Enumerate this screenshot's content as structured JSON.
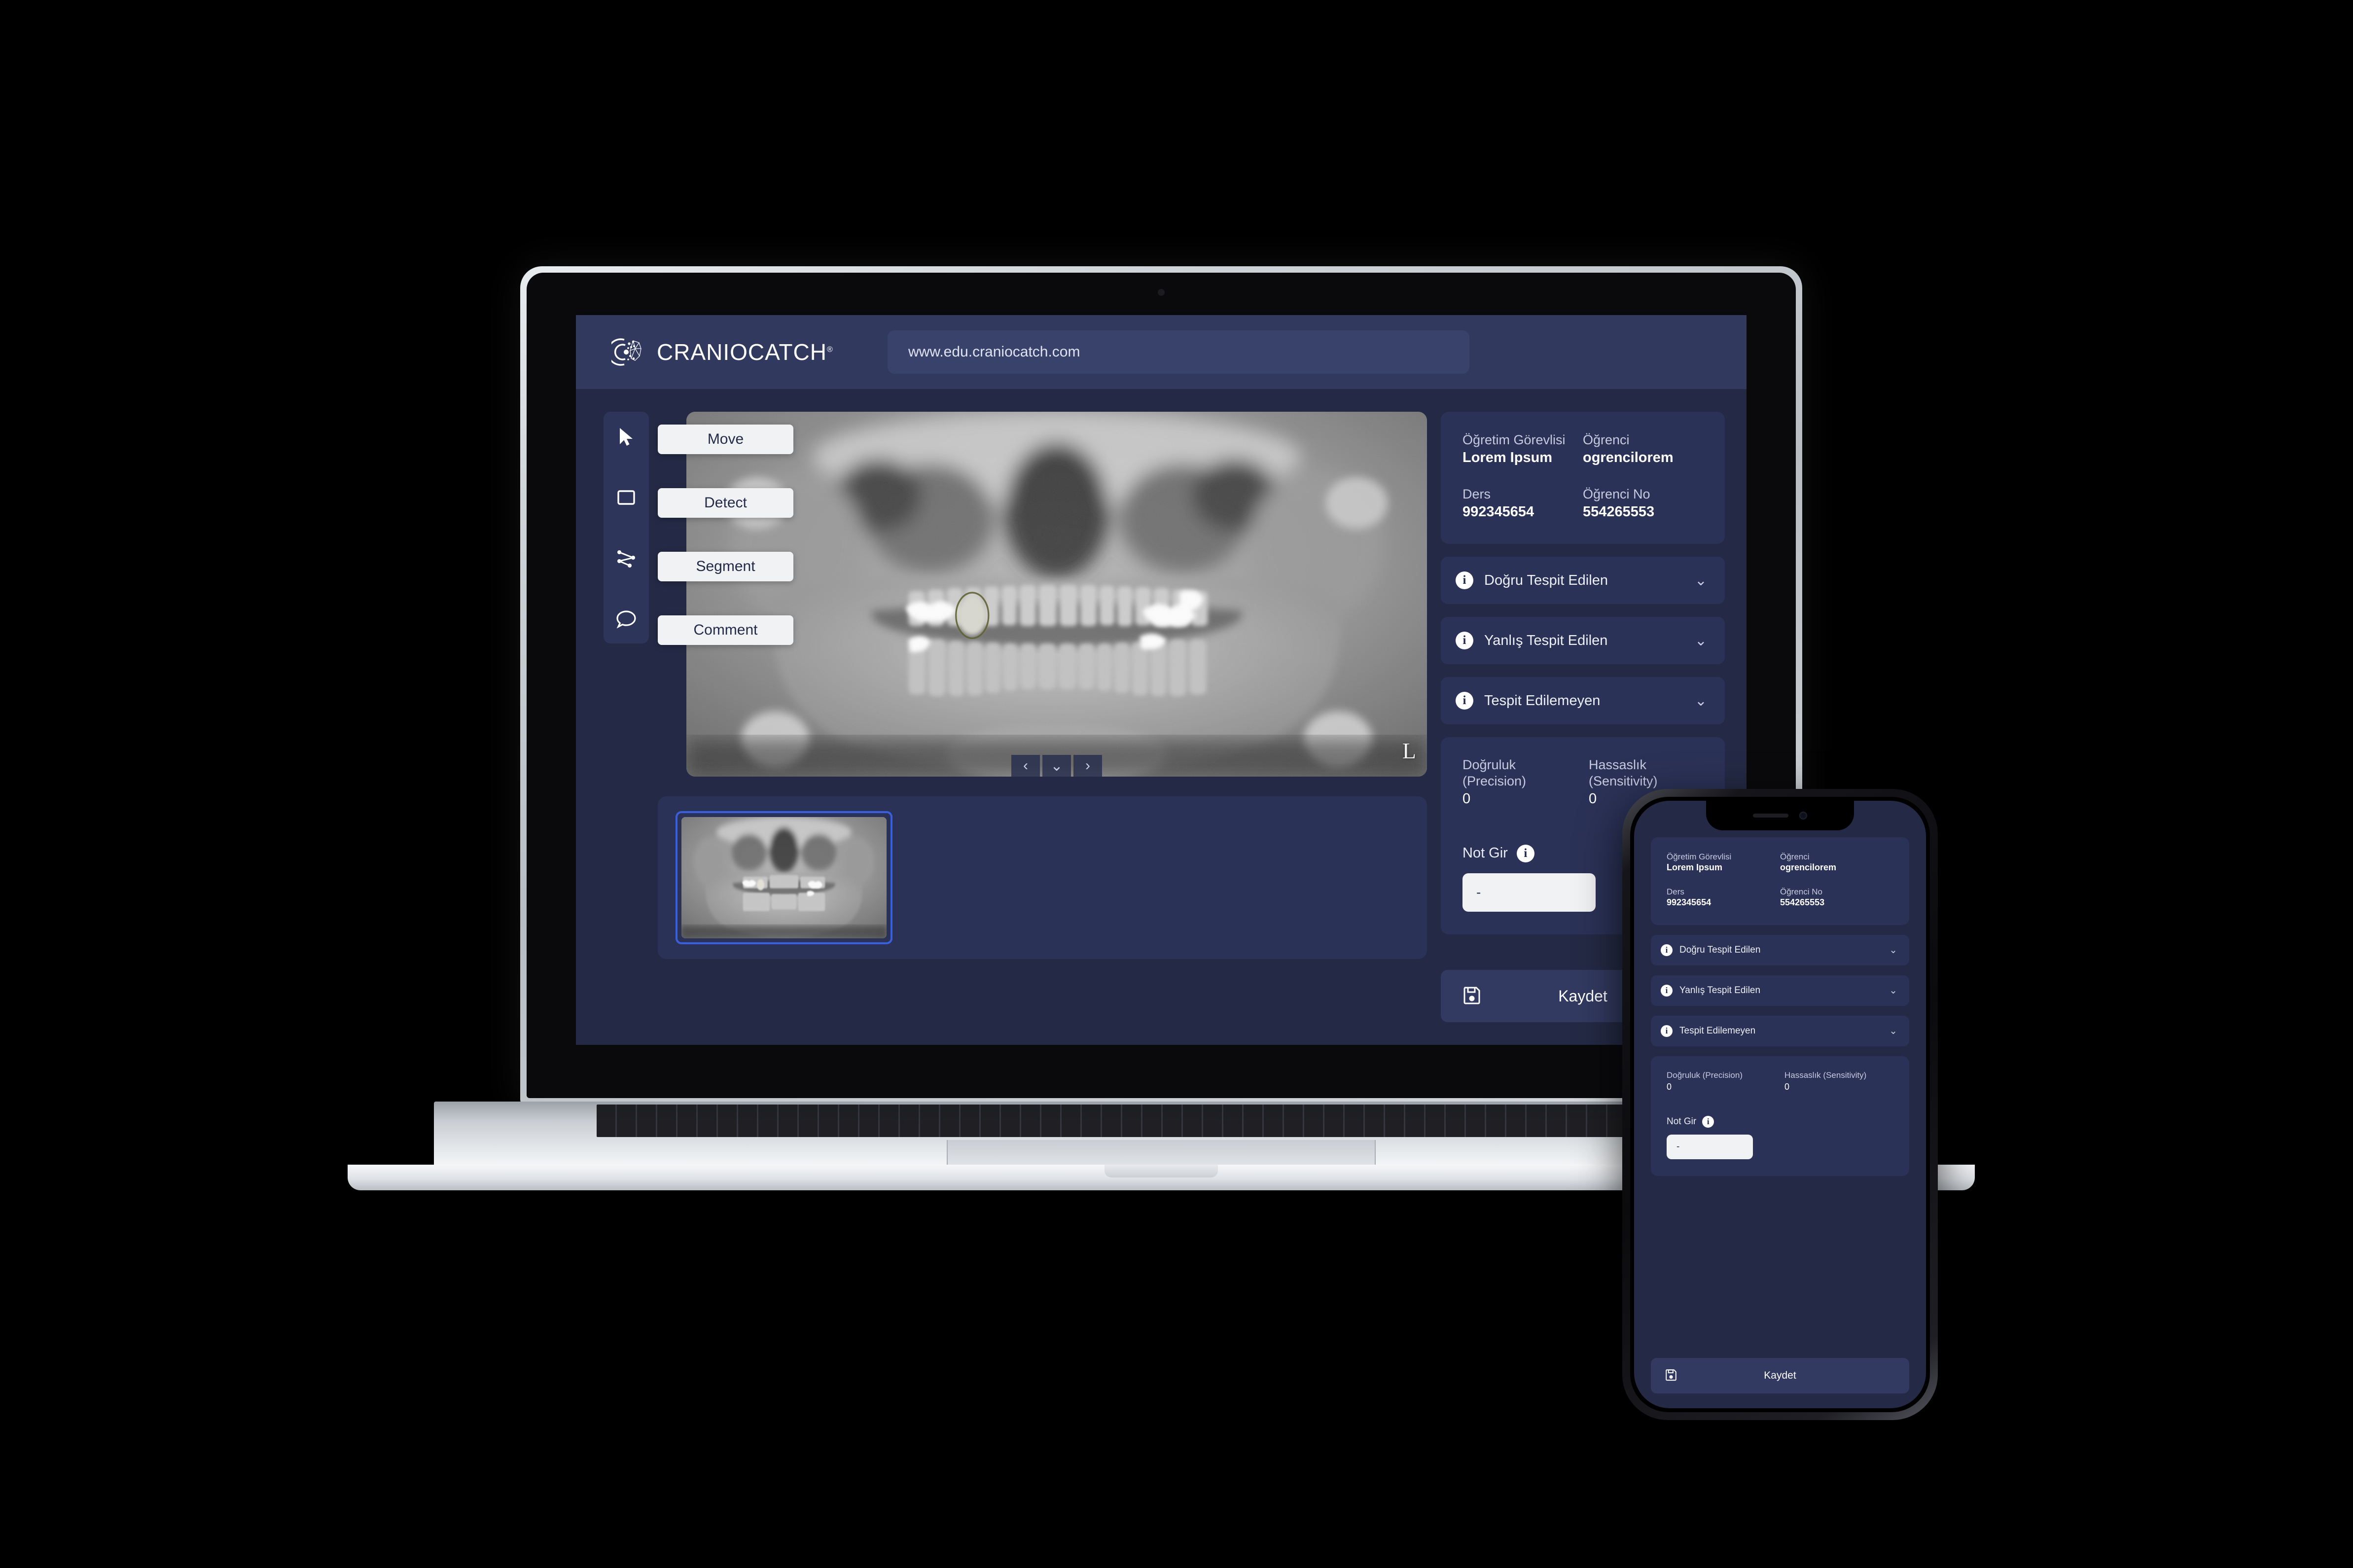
{
  "brand": {
    "name": "CRANIOCATCH",
    "registered_mark": "®",
    "logo_icon": "craniocatch-logo-icon"
  },
  "browser": {
    "url": "www.edu.craniocatch.com"
  },
  "toolbar": {
    "tools": [
      {
        "icon": "cursor-arrow-icon",
        "name": "move-tool"
      },
      {
        "icon": "rectangle-icon",
        "name": "detect-tool"
      },
      {
        "icon": "polyline-nodes-icon",
        "name": "segment-tool"
      },
      {
        "icon": "speech-bubble-icon",
        "name": "comment-tool"
      }
    ]
  },
  "modes": [
    {
      "label": "Move"
    },
    {
      "label": "Detect"
    },
    {
      "label": "Segment"
    },
    {
      "label": "Comment"
    }
  ],
  "viewer": {
    "orientation_marker": "L",
    "nav": {
      "prev": "‹",
      "dropdown": "⌄",
      "next": "›"
    }
  },
  "thumbnails": [
    {
      "selected": true,
      "alt": "panoramic-dental-xray-thumbnail"
    }
  ],
  "info": {
    "fields": [
      {
        "label": "Öğretim Görevlisi",
        "value": "Lorem Ipsum"
      },
      {
        "label": "Öğrenci",
        "value": "ogrencilorem"
      },
      {
        "label": "Ders",
        "value": "992345654"
      },
      {
        "label": "Öğrenci No",
        "value": "554265553"
      }
    ]
  },
  "accordions": [
    {
      "label": "Doğru Tespit Edilen",
      "icon": "info-icon",
      "chevron": "⌄"
    },
    {
      "label": "Yanlış Tespit Edilen",
      "icon": "info-icon",
      "chevron": "⌄"
    },
    {
      "label": "Tespit Edilemeyen",
      "icon": "info-icon",
      "chevron": "⌄"
    }
  ],
  "metrics": {
    "precision": {
      "label": "Doğruluk (Precision)",
      "value": "0"
    },
    "sensitivity": {
      "label": "Hassaslık (Sensitivity)",
      "value": "0"
    },
    "note": {
      "label": "Not Gir",
      "icon": "info-icon",
      "value": "-"
    }
  },
  "actions": {
    "save": {
      "label": "Kaydet",
      "icon": "floppy-disk-save-icon"
    }
  },
  "colors": {
    "app_background": "#242a45",
    "header": "#313a5e",
    "card": "#2b3257",
    "accent_selection": "#3a5fdd",
    "text_primary": "#ffffff",
    "text_secondary": "#c6cbdf",
    "input_background": "#f1f2f4"
  }
}
